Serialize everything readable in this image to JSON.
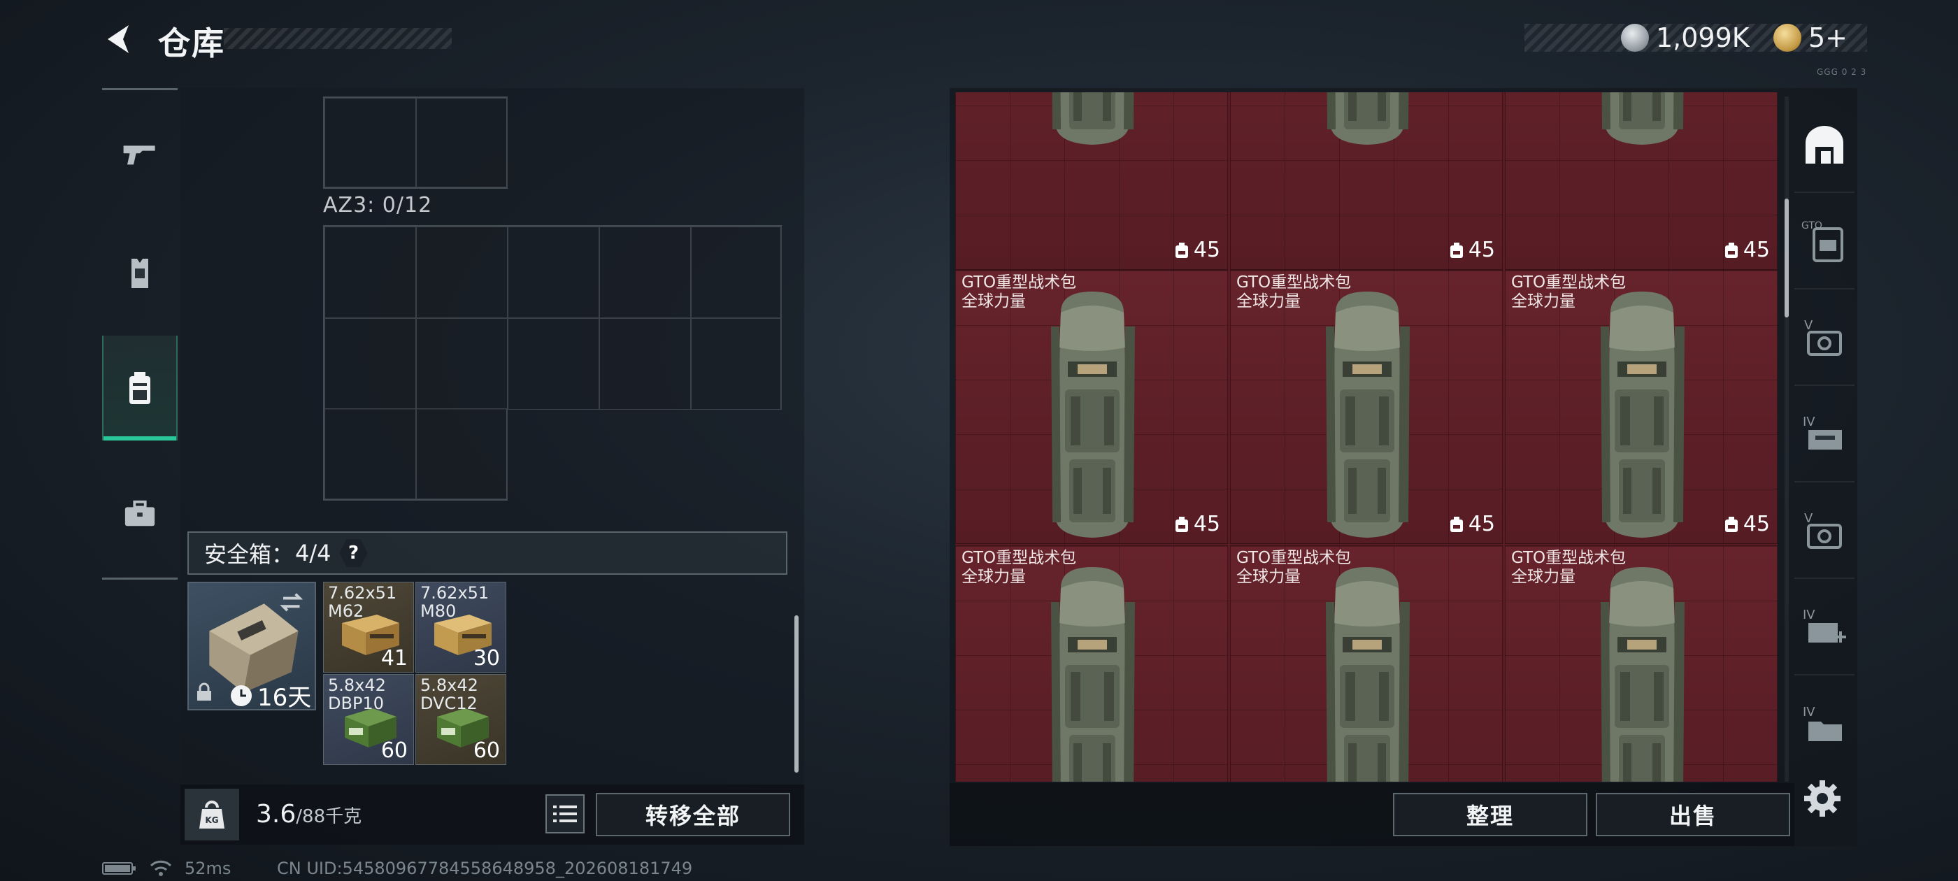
{
  "header": {
    "title": "仓库",
    "silver_amount": "1,099K",
    "gold_amount": "5+",
    "corner_text": "GGG 0 2 3"
  },
  "left_nav": {
    "items": [
      {
        "name": "weapons",
        "icon": "pistol-icon"
      },
      {
        "name": "armor",
        "icon": "vest-icon"
      },
      {
        "name": "backpack",
        "icon": "backpack-icon",
        "active": true
      },
      {
        "name": "supplies",
        "icon": "toolbox-icon"
      }
    ]
  },
  "storage": {
    "az3_label": "AZ3: 0/12"
  },
  "safe_box": {
    "label": "安全箱：",
    "count": "4/4",
    "help": "?",
    "timer": "16天",
    "items": [
      {
        "name": "7.62x51\nM62",
        "count": "41"
      },
      {
        "name": "7.62x51\nM80",
        "count": "30"
      },
      {
        "name": "5.8x42\nDBP10",
        "count": "60"
      },
      {
        "name": "5.8x42\nDVC12",
        "count": "60"
      }
    ]
  },
  "weight": {
    "current": "3.6",
    "max": "/88千克"
  },
  "buttons": {
    "transfer_all": "转移全部",
    "organize": "整理",
    "sell": "出售"
  },
  "bags": [
    {
      "name": "",
      "count": "45"
    },
    {
      "name": "",
      "count": "45"
    },
    {
      "name": "",
      "count": "45"
    },
    {
      "name": "GTO重型战术包\n全球力量",
      "count": "45"
    },
    {
      "name": "GTO重型战术包\n全球力量",
      "count": "45"
    },
    {
      "name": "GTO重型战术包\n全球力量",
      "count": "45"
    },
    {
      "name": "GTO重型战术包\n全球力量",
      "count": ""
    },
    {
      "name": "GTO重型战术包\n全球力量",
      "count": ""
    },
    {
      "name": "GTO重型战术包\n全球力量",
      "count": ""
    }
  ],
  "right_nav": {
    "items": [
      "home-base-icon",
      "GTO",
      "V",
      "IV",
      "V",
      "IV",
      "IV"
    ]
  },
  "status": {
    "ping": "52ms",
    "uid": "CN UID:54580967784558648958_202608181749"
  },
  "colors": {
    "accent": "#29c79a",
    "bag_tile": "#5e1e26"
  }
}
